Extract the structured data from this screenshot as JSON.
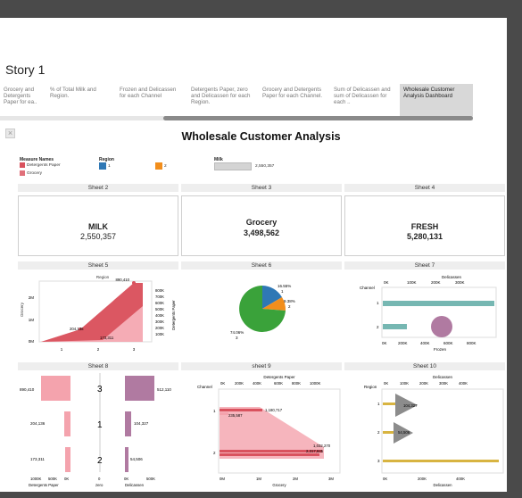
{
  "story": {
    "title": "Story 1"
  },
  "nav_tabs": [
    {
      "label": "Grocery and Detergents Paper for ea..",
      "active": false
    },
    {
      "label": "% of Total Milk and Region.",
      "active": false
    },
    {
      "label": "Frozen and Delicassen for each Channel",
      "active": false
    },
    {
      "label": "Detergents Paper, zero and Delicassen for each Region.",
      "active": false
    },
    {
      "label": "Grocery and Detergents Paper for each Channel.",
      "active": false
    },
    {
      "label": "Sum of Delicassen and sum of Delicassen for each ..",
      "active": false
    },
    {
      "label": "Wholesale Customer Analysis Dashboard",
      "active": true
    }
  ],
  "dashboard": {
    "title": "Wholesale Customer Analysis",
    "icon": "close-icon"
  },
  "legends": {
    "measure_names": {
      "title": "Measure Names",
      "items": [
        {
          "label": "Detergents Paper",
          "color": "#d9525e"
        },
        {
          "label": "Grocery",
          "color": "#f4a3ad"
        }
      ]
    },
    "region": {
      "title": "Region",
      "items": [
        {
          "label": "1",
          "color": "#1f77b4"
        },
        {
          "label": "2",
          "color": "#ff7f0e"
        }
      ]
    },
    "milk": {
      "title": "Milk",
      "value": "2,550,357"
    }
  },
  "colors": {
    "blue": "#2f78b5",
    "orange": "#f28e1c",
    "green": "#3aa23a",
    "teal": "#76b7b2",
    "pink": "#f4a3ad",
    "red": "#d9525e",
    "purple": "#b07aa1",
    "grey": "#8c8c8c",
    "gold": "#d8b441",
    "lightpurple": "#c9a2c9"
  },
  "sheets": {
    "s2": {
      "title": "Sheet 2",
      "label": "MILK",
      "value": "2,550,357"
    },
    "s3": {
      "title": "Sheet 3",
      "label": "Grocery",
      "value": "3,498,562"
    },
    "s4": {
      "title": "Sheet 4",
      "label": "FRESH",
      "value": "5,280,131"
    },
    "s5": {
      "title": "Sheet 5",
      "header": "Region",
      "ylabel_left": "Grocery",
      "ylabel_right": "Detergents Paper",
      "left_ticks": [
        "2M",
        "1M",
        "0M"
      ],
      "right_ticks": [
        "800K",
        "700K",
        "600K",
        "500K",
        "400K",
        "300K",
        "200K",
        "100K"
      ],
      "x_ticks": [
        "1",
        "2",
        "3"
      ],
      "labels": [
        "890,410",
        "204,136",
        "173,311"
      ]
    },
    "s6": {
      "title": "Sheet 6",
      "labels": [
        "16.55%",
        "1",
        "9.38%",
        "2",
        "74.06%",
        "3"
      ]
    },
    "s7": {
      "title": "Sheet 7",
      "top_title": "Delicassen",
      "top_ticks": [
        "0K",
        "100K",
        "200K",
        "300K"
      ],
      "row_header": "Channel",
      "rows": [
        "1",
        "2"
      ],
      "bottom_ticks": [
        "0K",
        "200K",
        "400K",
        "600K",
        "800K"
      ],
      "bottom_title": "Frozen"
    },
    "s8": {
      "title": "Sheet 8",
      "left_labels": [
        "890,410",
        "204,136",
        "173,311"
      ],
      "center": [
        "3",
        "1",
        "2"
      ],
      "right_labels": [
        "512,110",
        "104,327",
        "54,506"
      ],
      "left_ticks": [
        "1000K",
        "500K",
        "0K"
      ],
      "left_title": "Detergents Paper",
      "center_tick": "0",
      "center_title": "zero",
      "right_ticks": [
        "0K",
        "500K"
      ],
      "right_title": "Delicassen"
    },
    "s9": {
      "title": "sheet 9",
      "top_title": "Detergents Paper",
      "row_header": "Channel",
      "top_ticks": [
        "0K",
        "200K",
        "400K",
        "600K",
        "800K",
        "1000K"
      ],
      "rows": [
        "1",
        "2"
      ],
      "labels": [
        "1,180,717",
        "235,587",
        "1,032,270",
        "2,317,845"
      ],
      "bottom_ticks": [
        "0M",
        "1M",
        "2M",
        "3M"
      ],
      "bottom_title": "Grocery"
    },
    "s10": {
      "title": "Sheet 10",
      "top_title": "Delicassen",
      "row_header": "Region",
      "top_ticks": [
        "0K",
        "100K",
        "200K",
        "300K",
        "400K"
      ],
      "rows": [
        "1",
        "2",
        "3"
      ],
      "labels": [
        "104,327",
        "54,506"
      ],
      "bottom_ticks": [
        "0K",
        "200K",
        "400K"
      ],
      "bottom_title": "Delicassen"
    }
  }
}
